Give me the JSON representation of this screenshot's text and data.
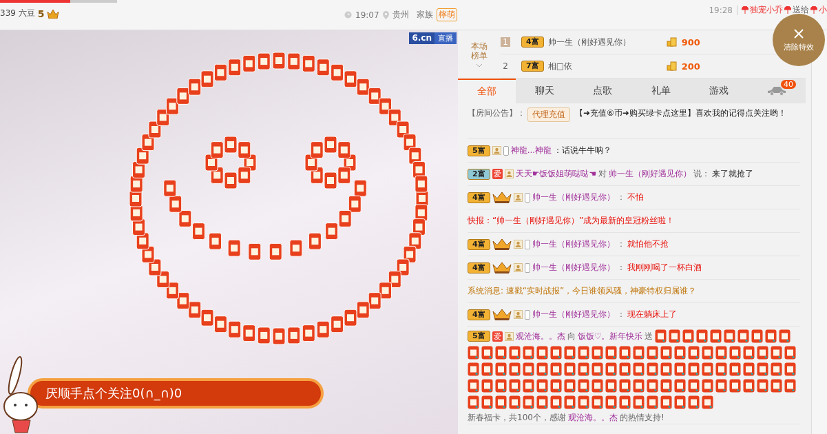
{
  "top_bar": {
    "progress": {
      "level": 0.6
    },
    "beans": "339 六豆",
    "fan_level": "5",
    "time": "19:07",
    "location": "贵州",
    "family_label": "家族",
    "family_tag": "檸萌"
  },
  "gift_ticker": {
    "time": "19:28",
    "sender": "独宠小乔",
    "verb": "送给",
    "receiver": "小"
  },
  "video": {
    "logo": "6.cn",
    "live": "直播",
    "banner": "厌顺手点个关注0(∩_∩)0"
  },
  "clear_effects": "清除特效",
  "ranking": {
    "title": "本场榜单",
    "rows": [
      {
        "rank": "1",
        "badge": {
          "text": "4富",
          "color": "#f2b233"
        },
        "name": "帅一生（刚好遇见你）",
        "amount": "900"
      },
      {
        "rank": "2",
        "badge": {
          "text": "7富",
          "color": "#f2b233"
        },
        "name": "相□依",
        "amount": "200"
      }
    ]
  },
  "tabs": [
    {
      "label": "全部",
      "selected": true
    },
    {
      "label": "聊天",
      "selected": false
    },
    {
      "label": "点歌",
      "selected": false
    },
    {
      "label": "礼单",
      "selected": false
    },
    {
      "label": "游戏",
      "selected": false
    }
  ],
  "car_count": "40",
  "messages": [
    {
      "kind": "notice",
      "label": "【房间公告】：",
      "button": "代理充值",
      "text": "【➜充值⑥币➜购买绿卡点这里】喜欢我的记得点关注哟！"
    },
    {
      "kind": "chat",
      "badge": {
        "text": "5富",
        "color": "#f2b233"
      },
      "crown": false,
      "phone": true,
      "parts": [
        {
          "text": "神龍...神龍",
          "kind": "user"
        },
        {
          "text": "：话说牛牛呐？",
          "kind": "message"
        }
      ]
    },
    {
      "kind": "chat",
      "badge": {
        "text": "2富",
        "color": "#8fc9d6"
      },
      "tag": "爱",
      "crown": false,
      "phone": false,
      "parts": [
        {
          "text": "天天☛饭饭姐萌哒哒☚",
          "kind": "user"
        },
        {
          "text": "对",
          "kind": "plain"
        },
        {
          "text": "帅一生（刚好遇见你）",
          "kind": "user"
        },
        {
          "text": "说：",
          "kind": "plain"
        },
        {
          "text": "来了就抢了",
          "kind": "message"
        }
      ]
    },
    {
      "kind": "chat",
      "badge": {
        "text": "4富",
        "color": "#f2b233"
      },
      "crown": true,
      "phone": true,
      "parts": [
        {
          "text": "帅一生（刚好遇见你）",
          "kind": "user"
        },
        {
          "text": "：",
          "kind": "plain"
        },
        {
          "text": "不怕",
          "kind": "alert"
        }
      ]
    },
    {
      "kind": "flash",
      "text": "快报：“帅一生（刚好遇见你）”成为最新的皇冠粉丝啦！"
    },
    {
      "kind": "chat",
      "badge": {
        "text": "4富",
        "color": "#f2b233"
      },
      "crown": true,
      "phone": true,
      "parts": [
        {
          "text": "帅一生（刚好遇见你）",
          "kind": "user"
        },
        {
          "text": "：",
          "kind": "plain"
        },
        {
          "text": "就怕他不抢",
          "kind": "alert"
        }
      ]
    },
    {
      "kind": "chat",
      "badge": {
        "text": "4富",
        "color": "#f2b233"
      },
      "crown": true,
      "phone": true,
      "parts": [
        {
          "text": "帅一生（刚好遇见你）",
          "kind": "user"
        },
        {
          "text": "：",
          "kind": "plain"
        },
        {
          "text": "我刚刚喝了一杯白酒",
          "kind": "alert"
        }
      ]
    },
    {
      "kind": "system",
      "text": "系统消息: 速戳“实时战报”，今日谁领风骚，神豪特权归属谁？"
    },
    {
      "kind": "chat",
      "badge": {
        "text": "4富",
        "color": "#f2b233"
      },
      "crown": true,
      "phone": true,
      "parts": [
        {
          "text": "帅一生（刚好遇见你）",
          "kind": "user"
        },
        {
          "text": "：",
          "kind": "plain"
        },
        {
          "text": "现在躺床上了",
          "kind": "alert"
        }
      ]
    },
    {
      "kind": "gift",
      "badge": {
        "text": "5富",
        "color": "#f2b233"
      },
      "tag": "爱",
      "parts": [
        {
          "text": "观沧海。。杰",
          "kind": "user"
        },
        {
          "text": "向",
          "kind": "plain"
        },
        {
          "text": "饭饭♡。新年快乐",
          "kind": "user"
        },
        {
          "text": "送",
          "kind": "plain"
        }
      ],
      "tail": [
        {
          "text": "新春福卡，共100个，感谢",
          "kind": "plain"
        },
        {
          "text": "观沧海。。杰",
          "kind": "user"
        },
        {
          "text": "的热情支持!",
          "kind": "plain"
        }
      ]
    }
  ]
}
